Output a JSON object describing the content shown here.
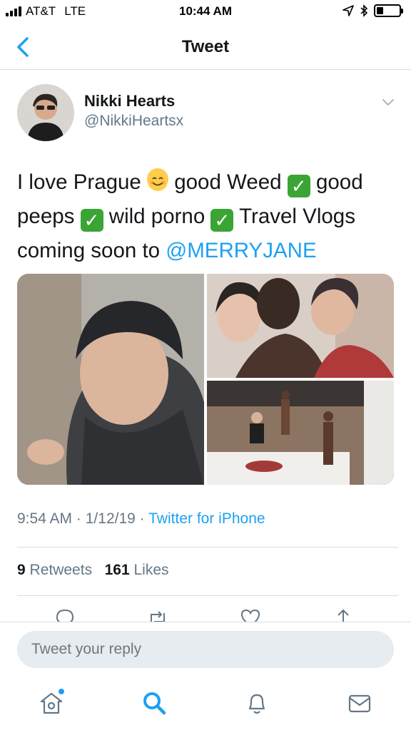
{
  "status_bar": {
    "carrier": "AT&T",
    "network": "LTE",
    "time": "10:44 AM",
    "battery_level": 0.3
  },
  "nav": {
    "title": "Tweet"
  },
  "tweet": {
    "display_name": "Nikki Hearts",
    "handle": "@NikkiHeartsx",
    "text_parts": {
      "p1": "I love Prague ",
      "p2": " good Weed ",
      "p3": " good peeps ",
      "p4": " wild porno ",
      "p5": " Travel Vlogs coming soon to ",
      "mention": "@MERRYJANE"
    },
    "time": "9:54 AM",
    "date": "1/12/19",
    "separator": "·",
    "source": "Twitter for iPhone",
    "retweets_count": "9",
    "retweets_label": "Retweets",
    "likes_count": "161",
    "likes_label": "Likes"
  },
  "reply": {
    "placeholder": "Tweet your reply"
  },
  "icons": {
    "back": "chevron-left-icon",
    "caret": "chevron-down-icon",
    "reply": "reply-icon",
    "retweet": "retweet-icon",
    "like": "heart-icon",
    "share": "share-icon",
    "home": "home-icon",
    "search": "search-icon",
    "notifications": "bell-icon",
    "messages": "mail-icon"
  },
  "colors": {
    "accent": "#1da1f2",
    "secondary_text": "#657786",
    "primary_text": "#14171a"
  }
}
